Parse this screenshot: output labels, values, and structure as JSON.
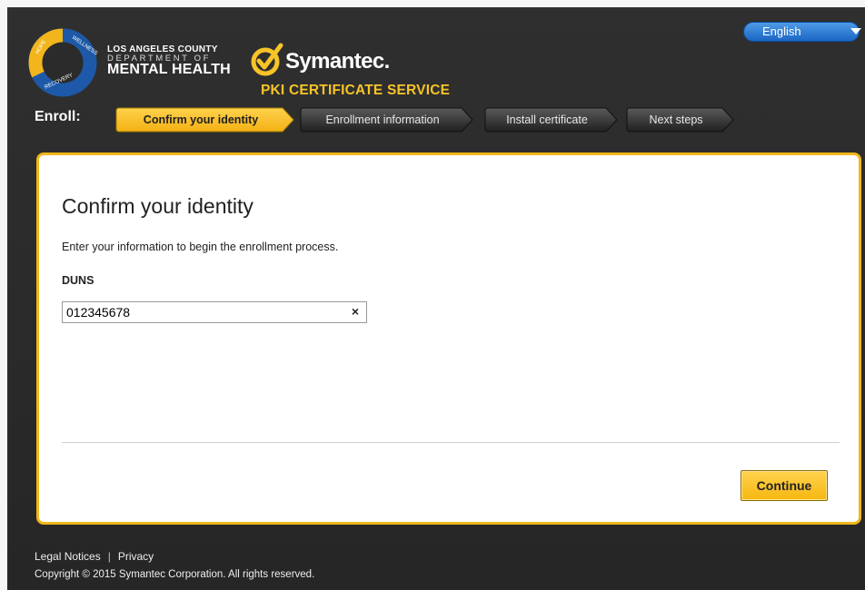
{
  "header": {
    "org_line1": "LOS ANGELES COUNTY",
    "org_line2": "DEPARTMENT OF",
    "org_line3": "MENTAL HEALTH",
    "ring_words": [
      "HOPE",
      "WELLNESS",
      "RECOVERY"
    ],
    "brand_name": "Symantec.",
    "service_name": "PKI CERTIFICATE SERVICE",
    "language": "English"
  },
  "enroll": {
    "label": "Enroll:",
    "steps": [
      {
        "label": "Confirm your identity",
        "active": true
      },
      {
        "label": "Enrollment information",
        "active": false
      },
      {
        "label": "Install certificate",
        "active": false
      },
      {
        "label": "Next steps",
        "active": false
      }
    ]
  },
  "panel": {
    "title": "Confirm your identity",
    "intro": "Enter your information to begin the enrollment process.",
    "field_label": "DUNS",
    "field_value": "012345678",
    "clear_glyph": "×",
    "continue_label": "Continue"
  },
  "footer": {
    "legal": "Legal Notices",
    "separator": "|",
    "privacy": "Privacy",
    "copyright": "Copyright © 2015 Symantec Corporation. All rights reserved."
  },
  "colors": {
    "accent_yellow": "#f2b61c",
    "background_dark": "#2b2b2b",
    "language_blue": "#2a78d4",
    "ring_blue": "#1f5fb0"
  }
}
